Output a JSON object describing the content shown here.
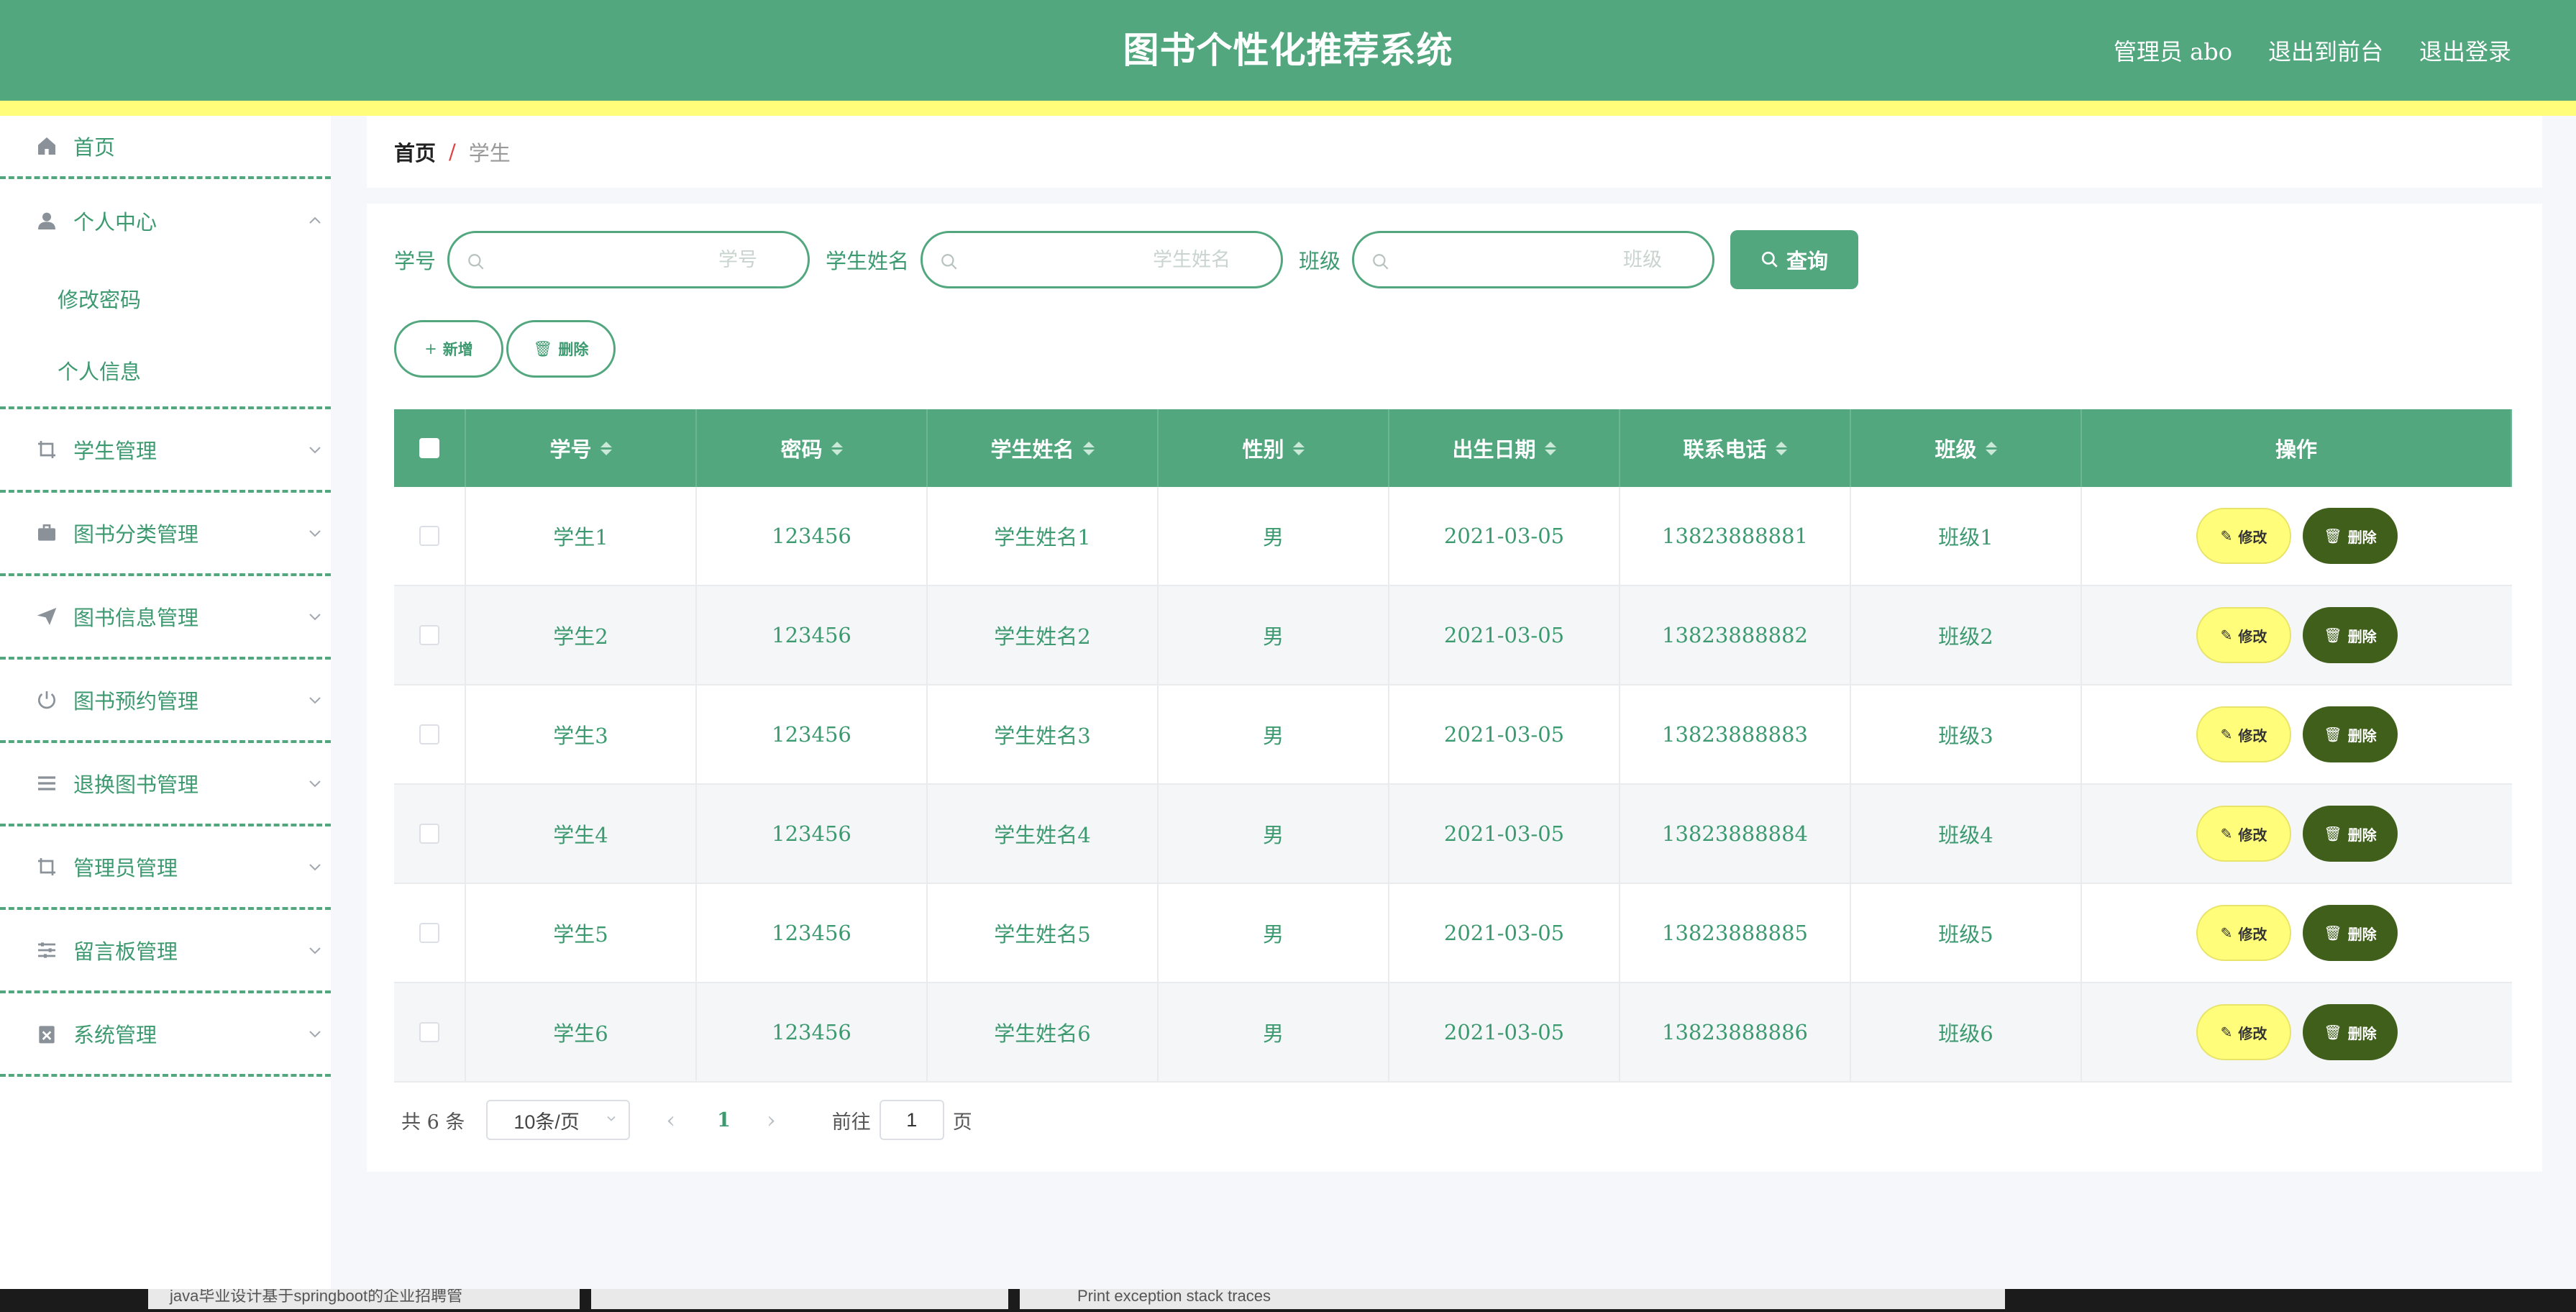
{
  "header": {
    "title": "图书个性化推荐系统",
    "admin": "管理员 abo",
    "to_front": "退出到前台",
    "logout": "退出登录"
  },
  "sidebar": {
    "home": "首页",
    "personal": "个人中心",
    "change_password": "修改密码",
    "personal_info": "个人信息",
    "items": [
      {
        "label": "学生管理",
        "icon": "crop-icon"
      },
      {
        "label": "图书分类管理",
        "icon": "briefcase-icon"
      },
      {
        "label": "图书信息管理",
        "icon": "send-icon"
      },
      {
        "label": "图书预约管理",
        "icon": "power-icon"
      },
      {
        "label": "退换图书管理",
        "icon": "list-icon"
      },
      {
        "label": "管理员管理",
        "icon": "crop-icon"
      },
      {
        "label": "留言板管理",
        "icon": "sliders-icon"
      },
      {
        "label": "系统管理",
        "icon": "clipboard-icon"
      }
    ]
  },
  "breadcrumb": {
    "home": "首页",
    "separator": "/",
    "current": "学生"
  },
  "search": {
    "student_no_label": "学号",
    "student_no_placeholder": "学号",
    "name_label": "学生姓名",
    "name_placeholder": "学生姓名",
    "class_label": "班级",
    "class_placeholder": "班级",
    "query_button": "查询"
  },
  "actions": {
    "add": "新增",
    "delete": "删除"
  },
  "table": {
    "columns": [
      "学号",
      "密码",
      "学生姓名",
      "性别",
      "出生日期",
      "联系电话",
      "班级",
      "操作"
    ],
    "edit_label": "修改",
    "delete_label": "删除",
    "rows": [
      [
        "学生1",
        "123456",
        "学生姓名1",
        "男",
        "2021-03-05",
        "13823888881",
        "班级1"
      ],
      [
        "学生2",
        "123456",
        "学生姓名2",
        "男",
        "2021-03-05",
        "13823888882",
        "班级2"
      ],
      [
        "学生3",
        "123456",
        "学生姓名3",
        "男",
        "2021-03-05",
        "13823888883",
        "班级3"
      ],
      [
        "学生4",
        "123456",
        "学生姓名4",
        "男",
        "2021-03-05",
        "13823888884",
        "班级4"
      ],
      [
        "学生5",
        "123456",
        "学生姓名5",
        "男",
        "2021-03-05",
        "13823888885",
        "班级5"
      ],
      [
        "学生6",
        "123456",
        "学生姓名6",
        "男",
        "2021-03-05",
        "13823888886",
        "班级6"
      ]
    ]
  },
  "pager": {
    "total": "共 6 条",
    "page_size": "10条/页",
    "current_page": "1",
    "goto": "前往",
    "goto_value": "1",
    "page_suffix": "页"
  },
  "taskbar": {
    "tab1": "java毕业设计基于springboot的企业招聘管",
    "tab3": "Print exception stack traces"
  },
  "colors": {
    "primary": "#52a77f",
    "accent_yellow": "#fffd7a",
    "delete_dark": "#3f5f1a"
  }
}
